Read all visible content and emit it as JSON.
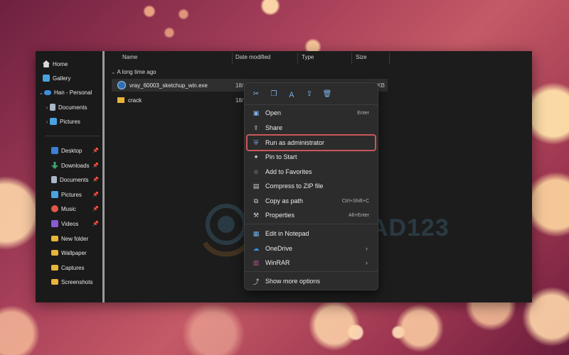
{
  "sidebar": {
    "items": [
      {
        "label": "Home",
        "icon": "home-icon",
        "color": "#d9d9d9"
      },
      {
        "label": "Gallery",
        "icon": "gallery-icon",
        "color": "#4aa3df"
      },
      {
        "label": "Han - Personal",
        "icon": "onedrive-cloud-icon",
        "color": "#3b8fe0"
      },
      {
        "label": "Documents",
        "icon": "documents-icon",
        "color": "#a9b7c6"
      },
      {
        "label": "Pictures",
        "icon": "pictures-icon",
        "color": "#4aa3df"
      },
      {
        "label": "Desktop",
        "icon": "desktop-icon",
        "color": "#3d7fd6"
      },
      {
        "label": "Downloads",
        "icon": "downloads-icon",
        "color": "#3ca66f"
      },
      {
        "label": "Documents",
        "icon": "documents-icon",
        "color": "#a9b7c6"
      },
      {
        "label": "Pictures",
        "icon": "pictures-icon",
        "color": "#4aa3df"
      },
      {
        "label": "Music",
        "icon": "music-icon",
        "color": "#e0584a"
      },
      {
        "label": "Videos",
        "icon": "videos-icon",
        "color": "#8a5ad6"
      },
      {
        "label": "New folder",
        "icon": "folder-icon",
        "color": "#e8b43a"
      },
      {
        "label": "Wallpaper",
        "icon": "folder-icon",
        "color": "#e8b43a"
      },
      {
        "label": "Captures",
        "icon": "folder-icon",
        "color": "#e8b43a"
      },
      {
        "label": "Screenshots",
        "icon": "folder-icon",
        "color": "#e8b43a"
      }
    ]
  },
  "columns": {
    "name": "Name",
    "date": "Date modified",
    "type": "Type",
    "size": "Size"
  },
  "group_label": "A long time ago",
  "files": [
    {
      "name": "vray_60003_sketchup_win.exe",
      "date": "18/",
      "size": "1 KB",
      "icon": "installer-icon",
      "selected": true
    },
    {
      "name": "crack",
      "date": "18/",
      "size": "",
      "icon": "folder-icon",
      "selected": false
    }
  ],
  "context_menu": {
    "quick_actions": [
      {
        "name": "cut-icon",
        "glyph": "✂"
      },
      {
        "name": "copy-icon",
        "glyph": "❐"
      },
      {
        "name": "rename-icon",
        "glyph": "Ａ"
      },
      {
        "name": "share-icon",
        "glyph": "⇪"
      },
      {
        "name": "delete-icon",
        "glyph": "🗑"
      }
    ],
    "items": [
      {
        "label": "Open",
        "shortcut": "Enter",
        "icon": "open-icon",
        "glyph": "▣",
        "color": "#7fb6ee"
      },
      {
        "label": "Share",
        "shortcut": "",
        "icon": "share-icon",
        "glyph": "⇪",
        "color": "#cfcfcf"
      },
      {
        "label": "Run as administrator",
        "shortcut": "",
        "icon": "shield-icon",
        "glyph": "⛨",
        "color": "#7fb6ee"
      },
      {
        "label": "Pin to Start",
        "shortcut": "",
        "icon": "pin-icon",
        "glyph": "✦",
        "color": "#cfcfcf"
      },
      {
        "label": "Add to Favorites",
        "shortcut": "",
        "icon": "star-icon",
        "glyph": "☆",
        "color": "#cfcfcf"
      },
      {
        "label": "Compress to ZIP file",
        "shortcut": "",
        "icon": "zip-icon",
        "glyph": "▤",
        "color": "#cfcfcf"
      },
      {
        "label": "Copy as path",
        "shortcut": "Ctrl+Shift+C",
        "icon": "copy-path-icon",
        "glyph": "⧉",
        "color": "#cfcfcf"
      },
      {
        "label": "Properties",
        "shortcut": "Alt+Enter",
        "icon": "wrench-icon",
        "glyph": "⚒",
        "color": "#cfcfcf"
      },
      {
        "label": "Edit in Notepad",
        "shortcut": "",
        "icon": "notepad-icon",
        "glyph": "▦",
        "color": "#6ab0ef"
      },
      {
        "label": "OneDrive",
        "shortcut": "",
        "icon": "onedrive-cloud-icon",
        "glyph": "☁",
        "color": "#3b8fe0",
        "submenu": true
      },
      {
        "label": "WinRAR",
        "shortcut": "",
        "icon": "winrar-icon",
        "glyph": "▥",
        "color": "#b0568c",
        "submenu": true
      },
      {
        "label": "Show more options",
        "shortcut": "",
        "icon": "more-options-icon",
        "glyph": "⤴",
        "color": "#cfcfcf"
      }
    ],
    "highlight_color": "#c9575a"
  },
  "watermark": {
    "text": "DOWNLOAD123"
  }
}
